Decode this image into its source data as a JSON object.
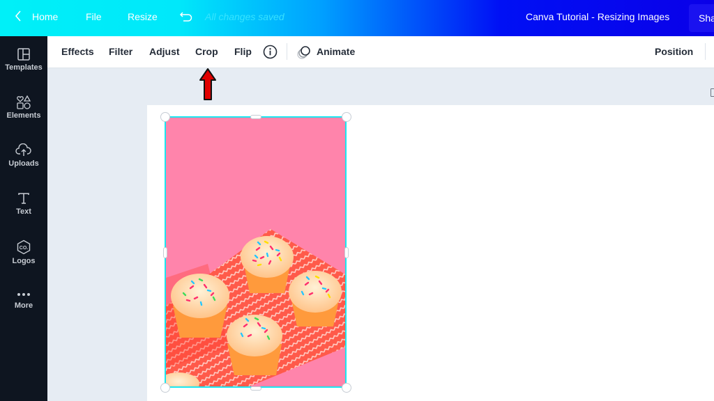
{
  "topbar": {
    "home_label": "Home",
    "file_label": "File",
    "resize_label": "Resize",
    "save_status": "All changes saved",
    "document_title": "Canva Tutorial - Resizing Images",
    "share_label": "Sha"
  },
  "sidebar": {
    "items": [
      {
        "label": "Templates",
        "icon": "templates-icon"
      },
      {
        "label": "Elements",
        "icon": "elements-icon"
      },
      {
        "label": "Uploads",
        "icon": "upload-cloud-icon"
      },
      {
        "label": "Text",
        "icon": "text-icon"
      },
      {
        "label": "Logos",
        "icon": "logos-icon"
      },
      {
        "label": "More",
        "icon": "more-dots-icon"
      }
    ]
  },
  "toolbar": {
    "effects_label": "Effects",
    "filter_label": "Filter",
    "adjust_label": "Adjust",
    "crop_label": "Crop",
    "flip_label": "Flip",
    "animate_label": "Animate",
    "position_label": "Position"
  },
  "canvas": {
    "image_description": "Pink background with frosted cupcakes and rainbow sprinkles on a red chevron napkin",
    "selection_color": "#19e7f0",
    "annotation_arrow_color": "#e00000"
  },
  "colors": {
    "topbar_start": "#00f0f8",
    "topbar_end": "#0a00e8",
    "sidebar_bg": "#0e1520",
    "canvas_bg": "#e6ecf3",
    "image_pink": "#ff84ab"
  }
}
